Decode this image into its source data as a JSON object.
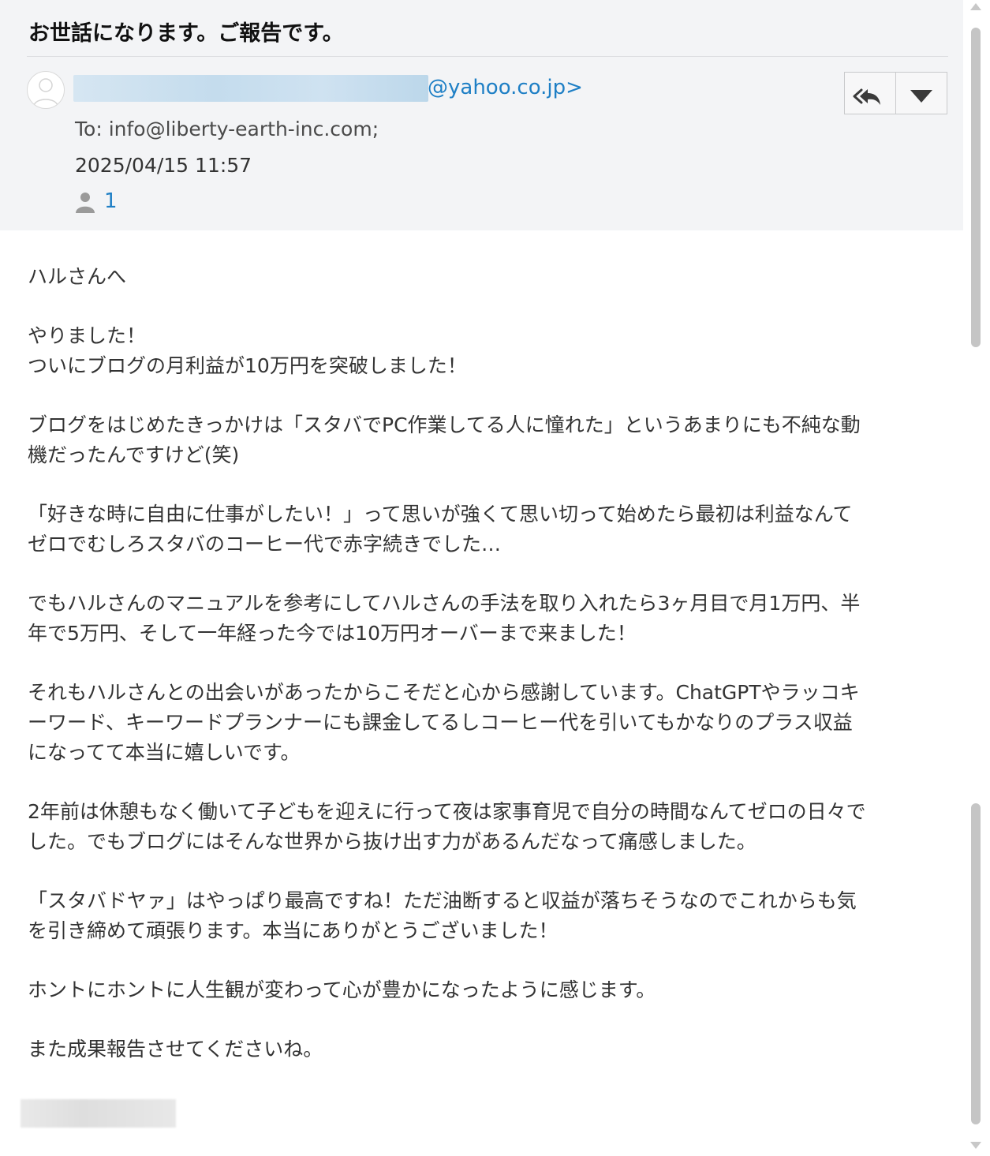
{
  "email": {
    "subject": "お世話になります。ご報告です。",
    "sender_domain": "@yahoo.co.jp>",
    "to_line": "To: info@liberty-earth-inc.com;",
    "date": "2025/04/15 11:57",
    "recipient_count": "1"
  },
  "icons": {
    "avatar": "user-avatar-icon",
    "recipients": "person-icon",
    "reply": "reply-all-icon",
    "more": "chevron-down-icon"
  },
  "body": {
    "paragraphs": [
      "ハルさんへ",
      "やりました！\nついにブログの月利益が10万円を突破しました！",
      "ブログをはじめたきっかけは「スタバでPC作業してる人に憧れた」というあまりにも不純な動\n機だったんですけど(笑)",
      "「好きな時に自由に仕事がしたい！」って思いが強くて思い切って始めたら最初は利益なんて\nゼロでむしろスタバのコーヒー代で赤字続きでした…",
      "でもハルさんのマニュアルを参考にしてハルさんの手法を取り入れたら3ヶ月目で月1万円、半\n年で5万円、そして一年経った今では10万円オーバーまで来ました！",
      "それもハルさんとの出会いがあったからこそだと心から感謝しています。ChatGPTやラッコキ\nーワード、キーワードプランナーにも課金してるしコーヒー代を引いてもかなりのプラス収益\nになってて本当に嬉しいです。",
      "2年前は休憩もなく働いて子どもを迎えに行って夜は家事育児で自分の時間なんてゼロの日々で\nした。でもブログにはそんな世界から抜け出す力があるんだなって痛感しました。",
      "「スタバドヤァ」はやっぱり最高ですね！ただ油断すると収益が落ちそうなのでこれからも気\nを引き締めて頑張ります。本当にありがとうございました！",
      "ホントにホントに人生観が変わって心が豊かになったように感じます。",
      "また成果報告させてくださいね。"
    ]
  },
  "colors": {
    "header_bg": "#f3f4f6",
    "link": "#1e7fc5",
    "text": "#333333"
  }
}
